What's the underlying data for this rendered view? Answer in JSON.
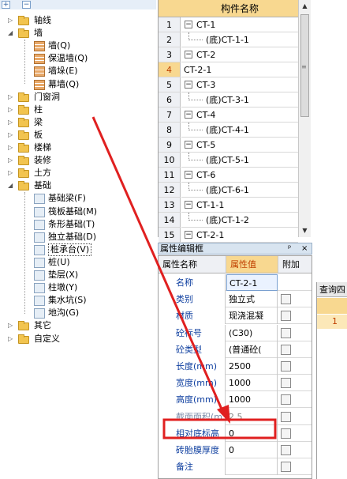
{
  "tree": {
    "toolbar": {
      "expand": "+",
      "collapse": "−"
    },
    "items": [
      {
        "label": "轴线",
        "type": "folder",
        "level": 0,
        "expander": "▷"
      },
      {
        "label": "墙",
        "type": "folder-open",
        "level": 0,
        "expander": "◢"
      },
      {
        "label": "墙(Q)",
        "type": "wall",
        "level": 1
      },
      {
        "label": "保温墙(Q)",
        "type": "wall",
        "level": 1
      },
      {
        "label": "墙垛(E)",
        "type": "wall",
        "level": 1
      },
      {
        "label": "幕墙(Q)",
        "type": "wall",
        "level": 1
      },
      {
        "label": "门窗洞",
        "type": "folder",
        "level": 0,
        "expander": "▷"
      },
      {
        "label": "柱",
        "type": "folder",
        "level": 0,
        "expander": "▷"
      },
      {
        "label": "梁",
        "type": "folder",
        "level": 0,
        "expander": "▷"
      },
      {
        "label": "板",
        "type": "folder",
        "level": 0,
        "expander": "▷"
      },
      {
        "label": "楼梯",
        "type": "folder",
        "level": 0,
        "expander": "▷"
      },
      {
        "label": "装修",
        "type": "folder",
        "level": 0,
        "expander": "▷"
      },
      {
        "label": "土方",
        "type": "folder",
        "level": 0,
        "expander": "▷"
      },
      {
        "label": "基础",
        "type": "folder-open",
        "level": 0,
        "expander": "◢"
      },
      {
        "label": "基础梁(F)",
        "type": "item",
        "level": 1
      },
      {
        "label": "筏板基础(M)",
        "type": "item",
        "level": 1
      },
      {
        "label": "条形基础(T)",
        "type": "item",
        "level": 1
      },
      {
        "label": "独立基础(D)",
        "type": "item",
        "level": 1
      },
      {
        "label": "桩承台(V)",
        "type": "item",
        "level": 1,
        "selected": true
      },
      {
        "label": "桩(U)",
        "type": "item",
        "level": 1
      },
      {
        "label": "垫层(X)",
        "type": "item",
        "level": 1
      },
      {
        "label": "柱墩(Y)",
        "type": "item",
        "level": 1
      },
      {
        "label": "集水坑(S)",
        "type": "item",
        "level": 1
      },
      {
        "label": "地沟(G)",
        "type": "item",
        "level": 1
      },
      {
        "label": "其它",
        "type": "folder",
        "level": 0,
        "expander": "▷"
      },
      {
        "label": "自定义",
        "type": "folder",
        "level": 0,
        "expander": "▷"
      }
    ]
  },
  "component_grid": {
    "header": "构件名称",
    "rows": [
      {
        "num": "1",
        "name": "CT-1",
        "box": "−",
        "child": false
      },
      {
        "num": "2",
        "name": "(底)CT-1-1",
        "child": true
      },
      {
        "num": "3",
        "name": "CT-2",
        "box": "−",
        "child": false
      },
      {
        "num": "4",
        "name": "CT-2-1",
        "child": false,
        "selected": true
      },
      {
        "num": "5",
        "name": "CT-3",
        "box": "−",
        "child": false
      },
      {
        "num": "6",
        "name": "(底)CT-3-1",
        "child": true
      },
      {
        "num": "7",
        "name": "CT-4",
        "box": "−",
        "child": false
      },
      {
        "num": "8",
        "name": "(底)CT-4-1",
        "child": true
      },
      {
        "num": "9",
        "name": "CT-5",
        "box": "−",
        "child": false
      },
      {
        "num": "10",
        "name": "(底)CT-5-1",
        "child": true
      },
      {
        "num": "11",
        "name": "CT-6",
        "box": "−",
        "child": false
      },
      {
        "num": "12",
        "name": "(底)CT-6-1",
        "child": true
      },
      {
        "num": "13",
        "name": "CT-1-1",
        "box": "−",
        "child": false
      },
      {
        "num": "14",
        "name": "(底)CT-1-2",
        "child": true
      },
      {
        "num": "15",
        "name": "CT-2-1",
        "box": "−",
        "child": false
      }
    ],
    "scroll_up": "▲",
    "scroll_down": "▼"
  },
  "property_panel": {
    "title": "属性编辑框",
    "pin": "ᵖ",
    "close": "×",
    "col_name": "属性名称",
    "col_value": "属性值",
    "col_extra": "附加",
    "rows": [
      {
        "name": "名称",
        "value": "CT-2-1",
        "selected": true,
        "check": false
      },
      {
        "name": "类别",
        "value": "独立式",
        "check": true
      },
      {
        "name": "材质",
        "value": "现浇混凝",
        "check": true
      },
      {
        "name": "砼标号",
        "value": "(C30)",
        "check": true
      },
      {
        "name": "砼类型",
        "value": "(普通砼(",
        "check": true
      },
      {
        "name": "长度(mm)",
        "value": "2500",
        "check": true
      },
      {
        "name": "宽度(mm)",
        "value": "1000",
        "check": true
      },
      {
        "name": "高度(mm)",
        "value": "1000",
        "check": true
      },
      {
        "name": "截面面积(m",
        "value": "2.5",
        "check": true,
        "dim": true
      },
      {
        "name": "相对底标高",
        "value": "0",
        "check": true,
        "highlight": true
      },
      {
        "name": "砖胎膜厚度",
        "value": "0",
        "check": true
      },
      {
        "name": "备注",
        "value": "",
        "check": true
      }
    ]
  },
  "query_panel": {
    "header": "查询四",
    "row_num": "1"
  },
  "annotation": {
    "arrow_color": "#e02020",
    "box_color": "#e02020"
  }
}
